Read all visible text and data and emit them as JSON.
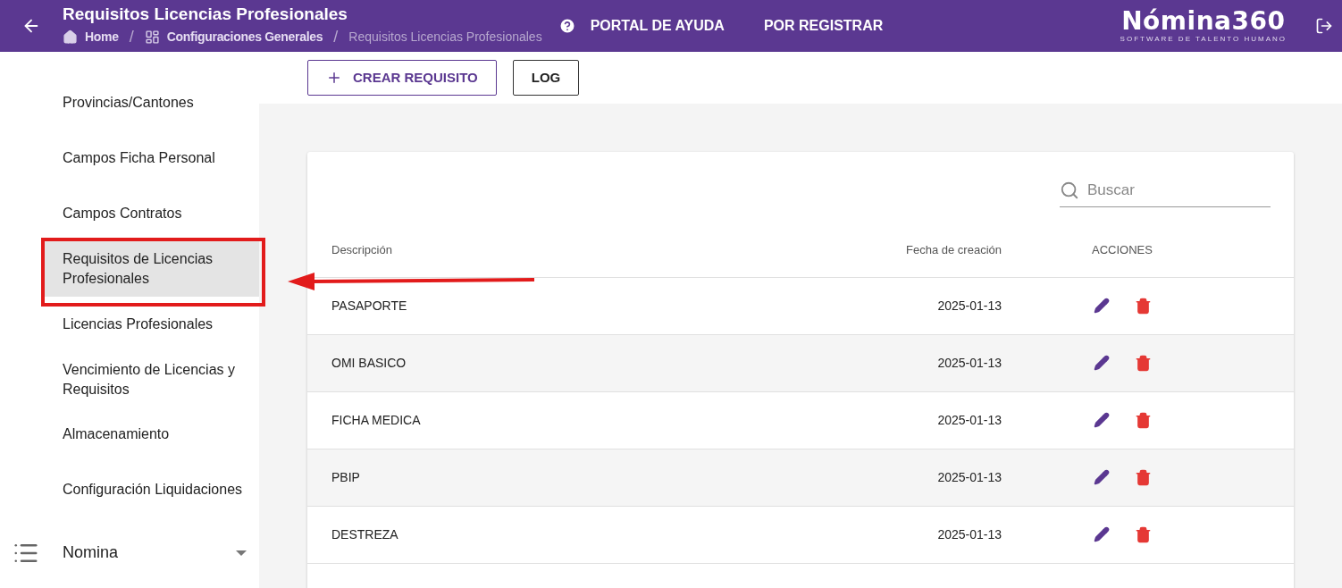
{
  "header": {
    "title": "Requisitos Licencias Profesionales",
    "breadcrumb": [
      {
        "kind": "link",
        "label": "Home",
        "current": false
      },
      {
        "kind": "separator",
        "label": "/"
      },
      {
        "kind": "link",
        "label": "Configuraciones Generales",
        "current": false
      },
      {
        "kind": "separator",
        "label": "/"
      },
      {
        "kind": "link",
        "label": "Requisitos Licencias Profesionales",
        "current": true
      }
    ],
    "links": [
      {
        "label": "PORTAL DE AYUDA"
      },
      {
        "label": "POR REGISTRAR"
      }
    ],
    "logo": {
      "name": "Nómina360",
      "tagline": "SOFTWARE DE TALENTO HUMANO"
    }
  },
  "sidebar": {
    "items": [
      {
        "label": "Provincias/Cantones",
        "selected": false
      },
      {
        "label": "Campos Ficha Personal",
        "selected": false
      },
      {
        "label": "Campos Contratos",
        "selected": false
      },
      {
        "label": "Requisitos de Licencias Profesionales",
        "selected": true
      },
      {
        "label": "Licencias Profesionales",
        "selected": false
      },
      {
        "label": "Vencimiento de Licencias y Requisitos",
        "selected": false
      },
      {
        "label": "Almacenamiento",
        "selected": false
      },
      {
        "label": "Configuración Liquidaciones",
        "selected": false
      }
    ],
    "section": {
      "label": "Nomina",
      "expanded": false
    }
  },
  "toolbar": {
    "buttons": [
      {
        "label": "CREAR REQUISITO",
        "kind": "primary"
      },
      {
        "label": "LOG",
        "kind": "plain"
      }
    ]
  },
  "table": {
    "search": {
      "placeholder": "Buscar"
    },
    "columns": [
      "Descripción",
      "Fecha de creación",
      "ACCIONES"
    ],
    "rows": [
      {
        "descripcion": "PASAPORTE",
        "fecha": "2025-01-13"
      },
      {
        "descripcion": "OMI BASICO",
        "fecha": "2025-01-13"
      },
      {
        "descripcion": "FICHA MEDICA",
        "fecha": "2025-01-13"
      },
      {
        "descripcion": "PBIP",
        "fecha": "2025-01-13"
      },
      {
        "descripcion": "DESTREZA",
        "fecha": "2025-01-13"
      }
    ]
  }
}
